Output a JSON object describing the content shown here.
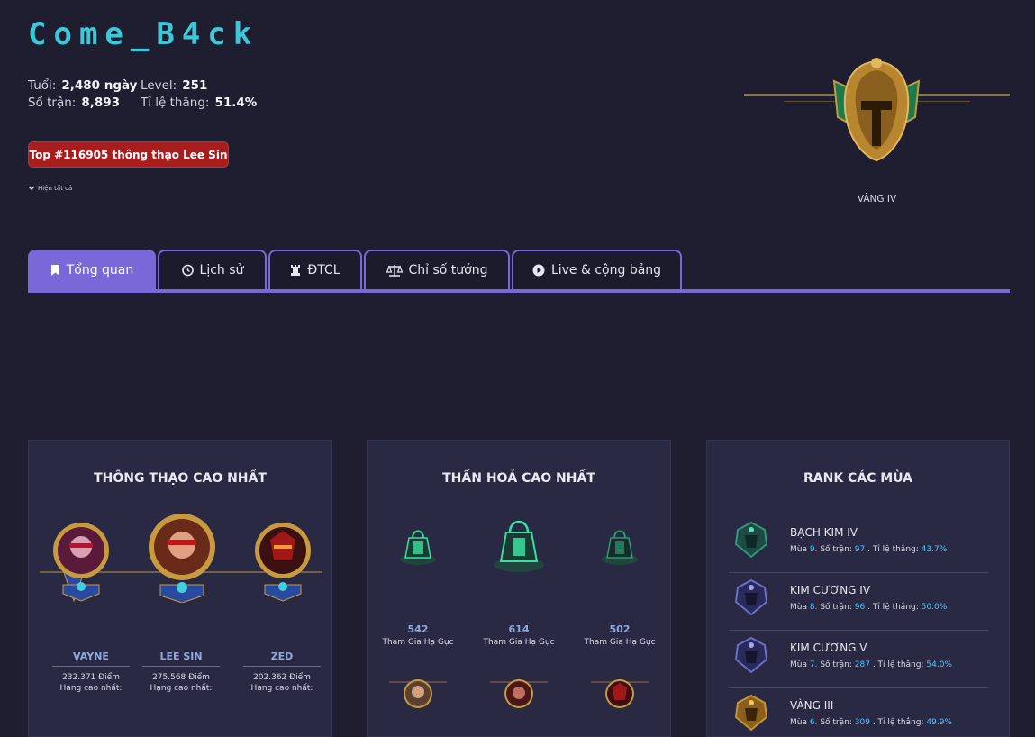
{
  "profile": {
    "name": "Come_B4ck",
    "age_label": "Tuổi:",
    "age_value": "2,480 ngày",
    "level_label": "Level:",
    "level_value": "251",
    "matches_label": "Số trận:",
    "matches_value": "8,893",
    "winrate_label": "Tỉ lệ thắng:",
    "winrate_value": "51.4%",
    "top_badge": "Top #116905 thông thạo Lee Sin",
    "show_all": "Hiện tất cả",
    "rank": "VÀNG IV"
  },
  "tabs": [
    {
      "label": "Tổng quan",
      "icon": "bookmark-icon",
      "active": true
    },
    {
      "label": "Lịch sử",
      "icon": "history-icon"
    },
    {
      "label": "ĐTCL",
      "icon": "rook-icon"
    },
    {
      "label": "Chỉ số tướng",
      "icon": "scale-icon"
    },
    {
      "label": "Live & cộng bảng",
      "icon": "play-icon"
    }
  ],
  "mastery": {
    "title": "THÔNG THẠO CAO NHẤT",
    "champions": [
      {
        "name": "VAYNE",
        "points": "232.371 Điểm",
        "rank": "Hạng cao nhất:"
      },
      {
        "name": "LEE SIN",
        "points": "275.568 Điểm",
        "rank": "Hạng cao nhất:"
      },
      {
        "name": "ZED",
        "points": "202.362 Điểm",
        "rank": "Hạng cao nhất:"
      }
    ]
  },
  "lanterns": {
    "title": "THẦN HOẢ CAO NHẤT",
    "items": [
      {
        "value": "542",
        "label": "Tham Gia Hạ Gục"
      },
      {
        "value": "614",
        "label": "Tham Gia Hạ Gục"
      },
      {
        "value": "502",
        "label": "Tham Gia Hạ Gục"
      }
    ]
  },
  "seasons": {
    "title": "RANK CÁC MÙA",
    "season_word": "Mùa",
    "matches_word": "Số trận:",
    "winrate_word": "Tỉ lệ thắng:",
    "items": [
      {
        "rank": "BẠCH KIM IV",
        "season": "9.",
        "matches": "97",
        "winrate": "43.7%",
        "color": "#2a9a7a"
      },
      {
        "rank": "KIM CƯƠNG IV",
        "season": "8.",
        "matches": "96",
        "winrate": "50.0%",
        "color": "#6a70c8"
      },
      {
        "rank": "KIM CƯƠNG V",
        "season": "7.",
        "matches": "287",
        "winrate": "54.0%",
        "color": "#6a70c8"
      },
      {
        "rank": "VÀNG III",
        "season": "6.",
        "matches": "309",
        "winrate": "49.9%",
        "color": "#c8962e"
      }
    ]
  },
  "colors": {
    "accent": "#7a68d8",
    "name": "#3cc8d8",
    "badge": "#a81e1e"
  }
}
